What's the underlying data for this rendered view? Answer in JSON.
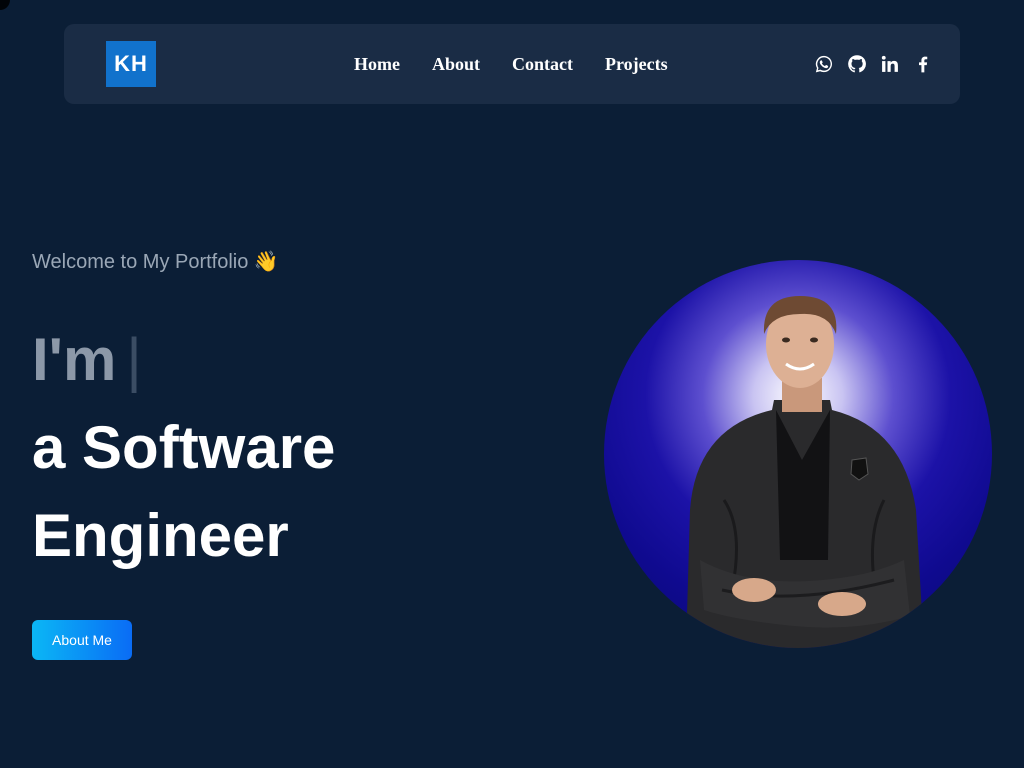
{
  "logo": {
    "text": "KH",
    "color": "#1172cc"
  },
  "nav": {
    "items": [
      {
        "label": "Home"
      },
      {
        "label": "About"
      },
      {
        "label": "Contact"
      },
      {
        "label": "Projects"
      }
    ]
  },
  "socials": [
    {
      "icon": "whatsapp-icon"
    },
    {
      "icon": "github-icon"
    },
    {
      "icon": "linkedin-icon"
    },
    {
      "icon": "facebook-icon"
    }
  ],
  "hero": {
    "welcome": "Welcome to My Portfolio 👋",
    "im": "I'm",
    "cursor": "|",
    "role_line1": "a Software",
    "role_line2": "Engineer",
    "button_label": "About Me"
  },
  "colors": {
    "background": "#0b1e36",
    "navbar": "#1a2c45",
    "button_gradient_start": "#0bb7f5",
    "button_gradient_end": "#0a6cf5",
    "portrait_bg": "#1c12a7"
  }
}
